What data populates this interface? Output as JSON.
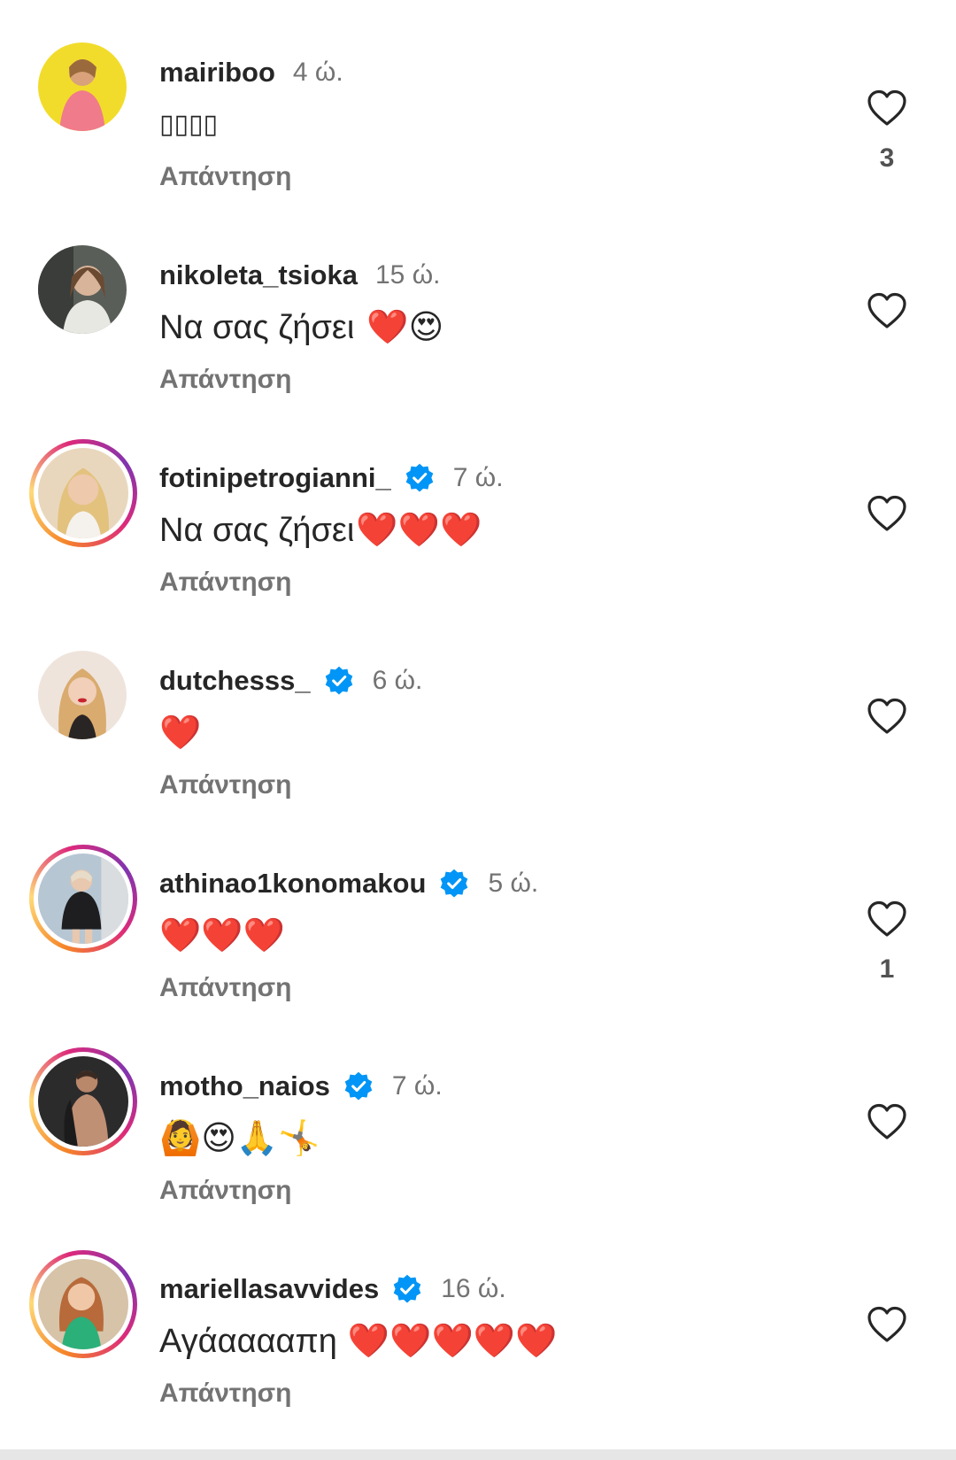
{
  "comments": [
    {
      "username": "mairiboo",
      "verified": false,
      "time": "4 ώ.",
      "text": "",
      "text_glyphs": "▯▯▯▯",
      "reply_label": "Απάντηση",
      "likes": "3",
      "avatar_style": "plain",
      "avatar_color": "#f2dc2b"
    },
    {
      "username": "nikoleta_tsioka",
      "verified": false,
      "time": "15 ώ.",
      "text": "Να σας ζήσει",
      "emojis": "❤️😍",
      "reply_label": "Απάντηση",
      "likes": "",
      "avatar_style": "plain",
      "avatar_color": "#5a5e58"
    },
    {
      "username": "fotinipetrogianni_",
      "verified": true,
      "time": "7 ώ.",
      "text": "Να σας ζήσει",
      "emojis": "❤️❤️❤️",
      "reply_label": "Απάντηση",
      "likes": "",
      "avatar_style": "ring",
      "avatar_color": "#e9d7bd"
    },
    {
      "username": "dutchesss_",
      "verified": true,
      "time": "6 ώ.",
      "text": "",
      "emojis": "❤️",
      "reply_label": "Απάντηση",
      "likes": "",
      "avatar_style": "plain",
      "avatar_color": "#efe4dc"
    },
    {
      "username": "athinao1konomakou",
      "verified": true,
      "time": "5 ώ.",
      "text": "",
      "emojis": "❤️❤️❤️",
      "reply_label": "Απάντηση",
      "likes": "1",
      "avatar_style": "ring",
      "avatar_color": "#b7c6d3"
    },
    {
      "username": "motho_naios",
      "verified": true,
      "time": "7 ώ.",
      "text": "",
      "emojis": "🙆😍🙏🤸",
      "reply_label": "Απάντηση",
      "likes": "",
      "avatar_style": "ring",
      "avatar_color": "#2c2b2c"
    },
    {
      "username": "mariellasavvides",
      "verified": true,
      "time": "16 ώ.",
      "text": "Αγάααααπη",
      "emojis": "❤️❤️❤️❤️❤️",
      "reply_label": "Απάντηση",
      "likes": "",
      "avatar_style": "ring",
      "avatar_color": "#d6c3a8"
    }
  ],
  "colors": {
    "verified_blue": "#0095f6",
    "heart_red": "#e0252e",
    "secondary_text": "#737373"
  },
  "icons": {
    "like": "heart-outline-icon",
    "verified": "verified-badge-icon"
  }
}
